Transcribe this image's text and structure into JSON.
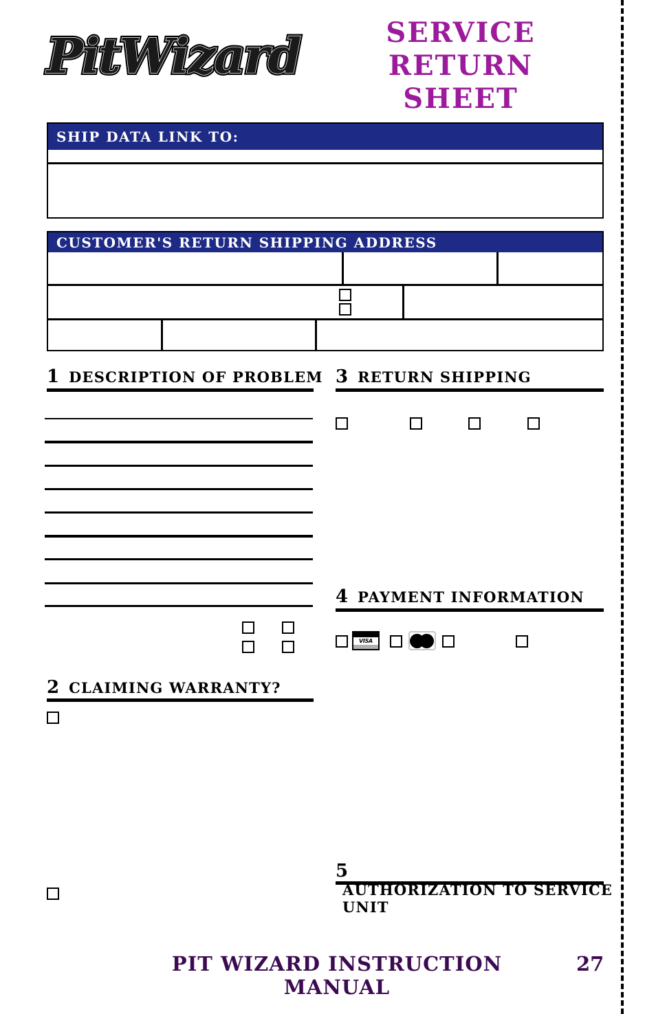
{
  "header": {
    "logo_text": "PitWizard",
    "logo_icon": "pitwizard-logo",
    "title_line1": "SERVICE RETURN",
    "title_line2": "SHEET",
    "title_color": "#9c1a9c"
  },
  "ship_box": {
    "heading": "SHIP DATA LINK TO:",
    "heading_bg": "#1d2a86",
    "heading_color": "#ffffff",
    "rows": [
      "",
      ""
    ]
  },
  "address_box": {
    "heading": "CUSTOMER'S RETURN SHIPPING ADDRESS",
    "heading_bg": "#1d2a86",
    "heading_color": "#ffffff",
    "row1": [
      "",
      "",
      ""
    ],
    "row2": [
      "",
      ""
    ],
    "row2_checkboxes": [
      "",
      ""
    ],
    "row3": [
      "",
      "",
      ""
    ]
  },
  "sections": {
    "s1": {
      "number": "1",
      "title": "DESCRIPTION OF PROBLEM",
      "lines": 9
    },
    "s2": {
      "number": "2",
      "title": "CLAIMING WARRANTY?",
      "checkboxes": [
        "",
        ""
      ]
    },
    "s3": {
      "number": "3",
      "title": "RETURN SHIPPING",
      "checkboxes": [
        "",
        "",
        "",
        ""
      ]
    },
    "s4": {
      "number": "4",
      "title": "PAYMENT INFORMATION",
      "checkboxes": [
        "",
        "",
        "",
        ""
      ],
      "visa_label": "VISA",
      "visa_icon": "visa-card-icon",
      "mastercard_icon": "mastercard-icon"
    },
    "s5": {
      "number": "5",
      "title": "AUTHORIZATION TO SERVICE UNIT"
    }
  },
  "problem_extra_checkboxes": [
    "",
    "",
    "",
    ""
  ],
  "footer": {
    "text": "PIT WIZARD INSTRUCTION MANUAL",
    "page": "27",
    "color": "#3c0a50"
  },
  "cut_line": "dashed-cut-line"
}
